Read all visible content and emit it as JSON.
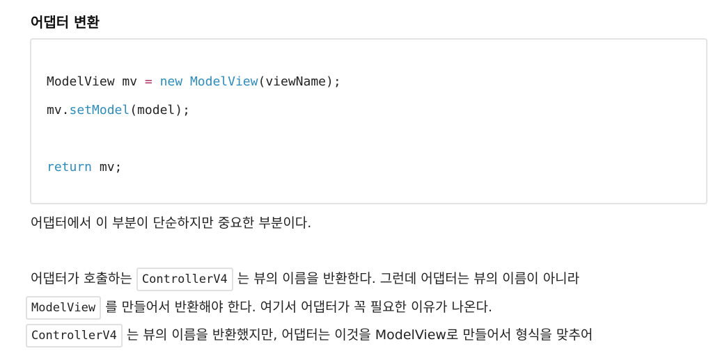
{
  "heading": "어댑터 변환",
  "code": {
    "line1": {
      "a": "ModelView mv ",
      "op": "=",
      "sp": " ",
      "kw": "new",
      "sp2": " ",
      "cls": "ModelView",
      "b": "(viewName);"
    },
    "line2": {
      "a": "mv.",
      "fn": "setModel",
      "b": "(model);"
    },
    "line3": {
      "kw": "return",
      "b": " mv;"
    }
  },
  "paragraphs": {
    "p1": "어댑터에서 이 부분이 단순하지만 중요한 부분이다.",
    "p2a": "어댑터가 호출하는 ",
    "p2code": "ControllerV4",
    "p2b": " 는 뷰의 이름을 반환한다. 그런데 어댑터는 뷰의 이름이 아니라",
    "p3code": "ModelView",
    "p3b": " 를 만들어서 반환해야 한다. 여기서 어댑터가 꼭 필요한 이유가 나온다.",
    "p4code": "ControllerV4",
    "p4b": " 는 뷰의 이름을 반환했지만, 어댑터는 이것을 ModelView로 만들어서 형식을 맞추어"
  }
}
